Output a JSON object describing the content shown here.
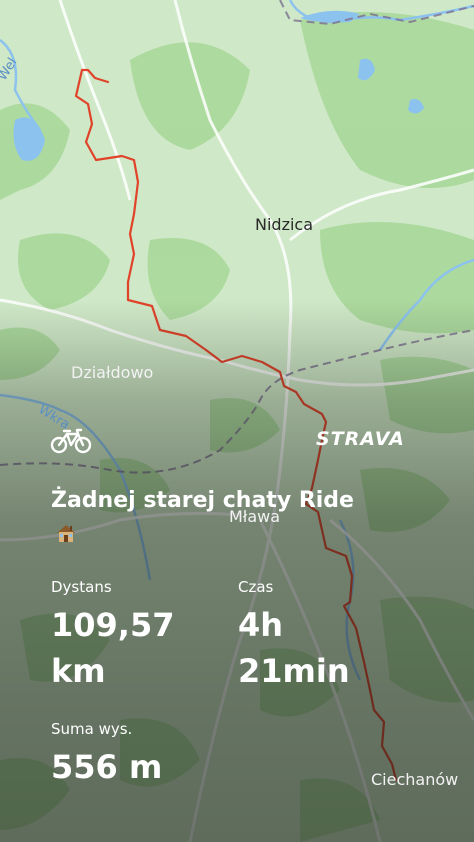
{
  "map": {
    "places": {
      "nidzica": "Nidzica",
      "dzialdowo": "Działdowo",
      "mlawa": "Mława",
      "ciechanow": "Ciechanów"
    },
    "rivers": {
      "wel": "Wel",
      "wkra": "Wkra"
    },
    "route_color": "#e0432a"
  },
  "brand": "STRAVA",
  "activity": {
    "sport_icon": "bicycle-icon",
    "title": "Żadnej starej chaty Ride",
    "title_emoji": "house-icon"
  },
  "stats": {
    "distance": {
      "label": "Dystans",
      "value": "109,57",
      "unit": "km"
    },
    "time": {
      "label": "Czas",
      "value": "4h",
      "unit": "21min"
    },
    "elevation": {
      "label": "Suma wys.",
      "value": "556 m"
    }
  }
}
